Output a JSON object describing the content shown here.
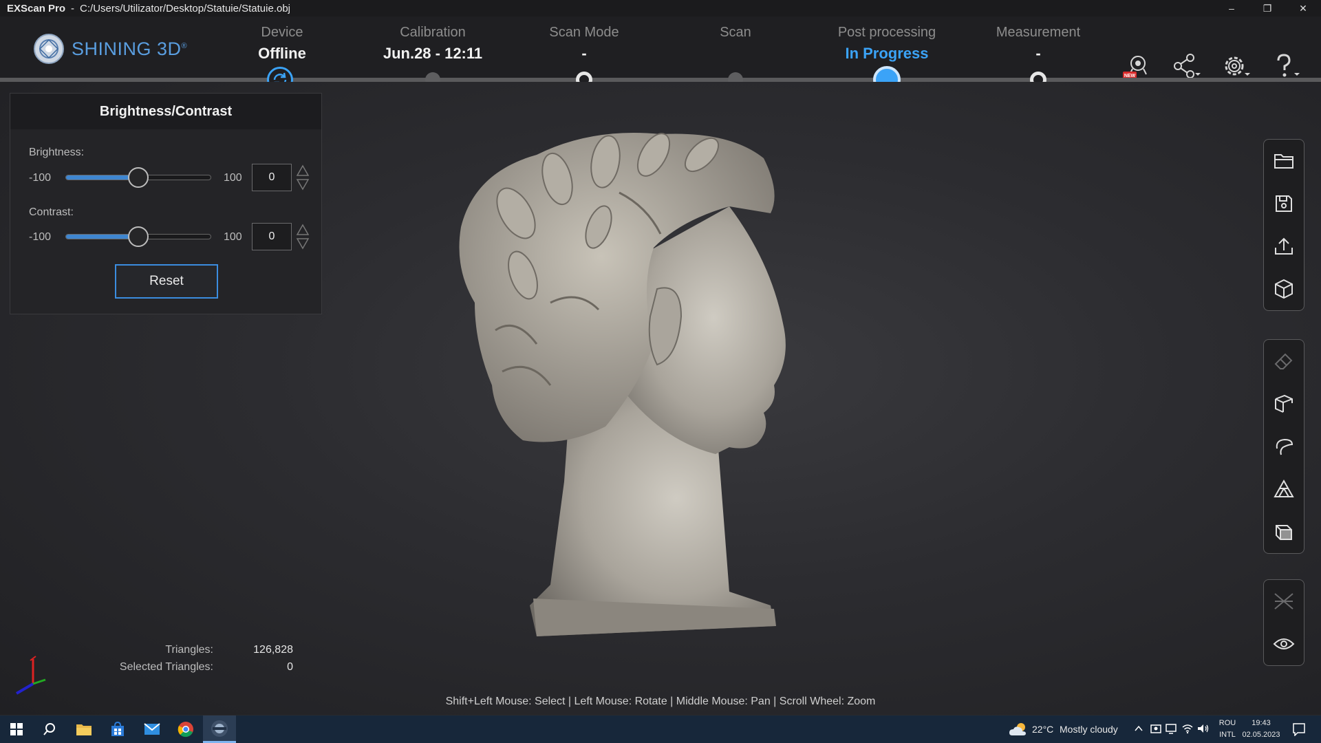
{
  "window": {
    "app_name": "EXScan Pro",
    "separator": "-",
    "file_path": "C:/Users/Utilizator/Desktop/Statuie/Statuie.obj",
    "minimize": "–",
    "restore": "❐",
    "close": "✕"
  },
  "brand": {
    "name": "SHINING 3D",
    "mark": "®"
  },
  "steps": [
    {
      "label": "Device",
      "value": "Offline",
      "state": "active"
    },
    {
      "label": "Calibration",
      "value": "Jun.28 - 12:11",
      "state": "done"
    },
    {
      "label": "Scan Mode",
      "value": "-",
      "state": "ring"
    },
    {
      "label": "Scan",
      "value": "",
      "state": "done"
    },
    {
      "label": "Post processing",
      "value": "In Progress",
      "state": "current"
    },
    {
      "label": "Measurement",
      "value": "-",
      "state": "ring"
    }
  ],
  "header_icons": [
    "scanner-new-icon",
    "share-icon",
    "settings-icon",
    "help-icon"
  ],
  "header_badge": "NEW",
  "panel": {
    "title": "Brightness/Contrast",
    "brightness": {
      "label": "Brightness:",
      "min": "-100",
      "max": "100",
      "value": "0",
      "level": 0.5
    },
    "contrast": {
      "label": "Contrast:",
      "min": "-100",
      "max": "100",
      "value": "0",
      "level": 0.5
    },
    "reset_label": "Reset"
  },
  "stats": {
    "triangles_label": "Triangles:",
    "triangles_value": "126,828",
    "selected_label": "Selected Triangles:",
    "selected_value": "0"
  },
  "hint": "Shift+Left Mouse: Select | Left Mouse: Rotate | Middle Mouse: Pan | Scroll Wheel: Zoom",
  "right_toolbar": {
    "file_group": [
      "open-folder-icon",
      "save-icon",
      "export-icon",
      "model-cube-icon"
    ],
    "edit_group": [
      "eraser-icon",
      "box-select-icon",
      "lasso-icon",
      "mesh-triangle-icon",
      "box-view-icon"
    ],
    "view_group": [
      "texture-icon",
      "eye-icon"
    ]
  },
  "taskbar": {
    "weather_temp": "22°C",
    "weather_text": "Mostly cloudy",
    "lang_top": "ROU",
    "lang_bottom": "INTL",
    "time": "19:43",
    "date": "02.05.2023"
  },
  "colors": {
    "accent": "#3ba3f7",
    "brand": "#5a9ee0",
    "background": "#2a2a2d"
  }
}
